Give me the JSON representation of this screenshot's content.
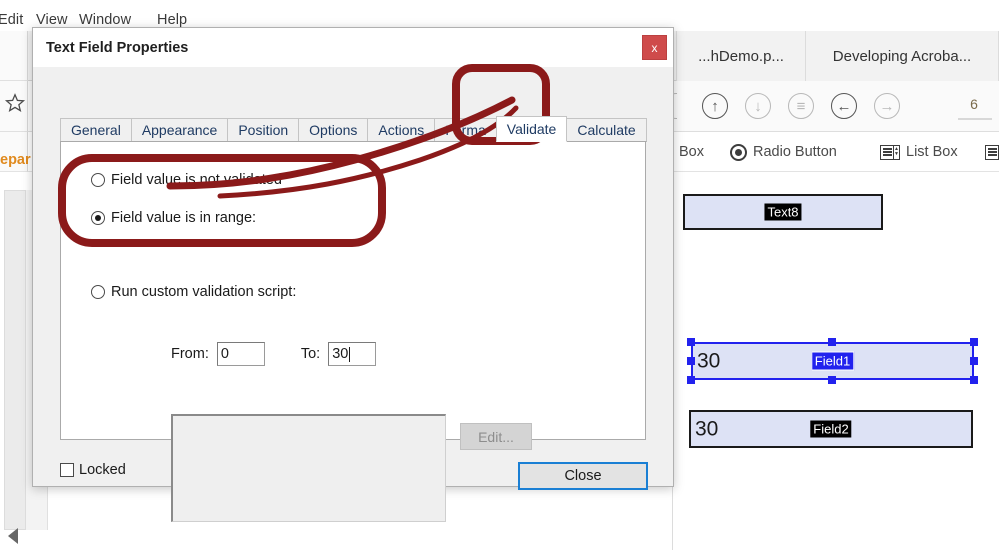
{
  "app": {
    "menu": [
      {
        "label": "Edit"
      },
      {
        "label": "View"
      },
      {
        "label": "Window"
      },
      {
        "label": "Help"
      }
    ],
    "document_tabs": [
      {
        "label": "...hDemo.p..."
      },
      {
        "label": "Developing Acroba..."
      }
    ],
    "toolbar": {
      "icons": [
        {
          "name": "star-icon",
          "glyph": "☆"
        },
        {
          "name": "arrow-up-circle-icon",
          "glyph": "↑"
        },
        {
          "name": "arrow-down-circle-icon",
          "glyph": "↓"
        },
        {
          "name": "fit-page-circle-icon",
          "glyph": "≡"
        },
        {
          "name": "previous-page-circle-icon",
          "glyph": "←"
        },
        {
          "name": "next-page-circle-icon",
          "glyph": "→"
        }
      ],
      "page_number": "6"
    },
    "form_toolbar": {
      "text_box_label": "Box",
      "radio_button_label": "Radio Button",
      "list_box_label": "List Box"
    },
    "left_rail": {
      "prepare_label_prefix": "",
      "prepare_label": "epar"
    },
    "pdf_fields": [
      {
        "name": "Text8",
        "value": "",
        "selected": false
      },
      {
        "name": "Field1",
        "value": "30",
        "selected": true
      },
      {
        "name": "Field2",
        "value": "30",
        "selected": false
      }
    ]
  },
  "dialog": {
    "title": "Text Field Properties",
    "close_icon_label": "x",
    "tabs": [
      {
        "label": "General",
        "active": false
      },
      {
        "label": "Appearance",
        "active": false
      },
      {
        "label": "Position",
        "active": false
      },
      {
        "label": "Options",
        "active": false
      },
      {
        "label": "Actions",
        "active": false
      },
      {
        "label": "Forma",
        "active": false
      },
      {
        "label": "Validate",
        "active": true
      },
      {
        "label": "Calculate",
        "active": false
      }
    ],
    "validate": {
      "option_not_validated": "Field value is not validated",
      "option_in_range": "Field value is in range:",
      "option_custom_script": "Run custom validation script:",
      "selected_option": "in_range",
      "from_label": "From:",
      "from_value": "0",
      "to_label": "To:",
      "to_value": "30",
      "script_value": "",
      "edit_button_label": "Edit..."
    },
    "footer": {
      "locked_label": "Locked",
      "locked_checked": false,
      "close_button_label": "Close"
    }
  },
  "annotation": {
    "color": "#8B1A1A",
    "shapes": [
      "rounded-rect-around-validate-tab",
      "rounded-rect-around-range-option",
      "connector-line"
    ]
  }
}
